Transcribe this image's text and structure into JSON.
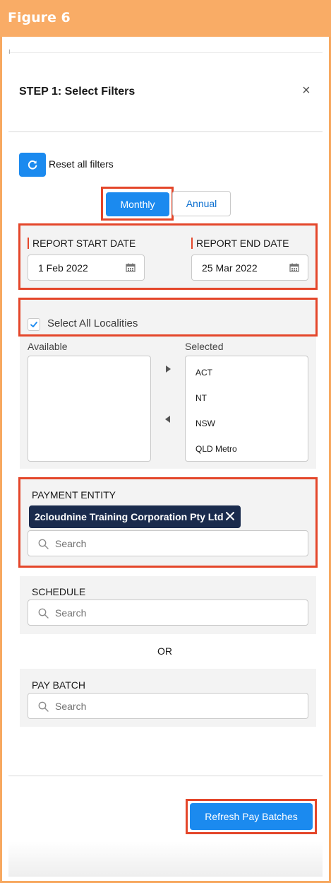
{
  "figure": {
    "title": "Figure 6"
  },
  "modal": {
    "title": "STEP 1: Select Filters",
    "close_label": "×"
  },
  "reset": {
    "label": "Reset all filters",
    "icon": "refresh-icon"
  },
  "period_toggle": {
    "options": [
      "Monthly",
      "Annual"
    ],
    "selected": "Monthly"
  },
  "dates": {
    "start_label": "REPORT START DATE",
    "start_value": "1 Feb 2022",
    "end_label": "REPORT END DATE",
    "end_value": "25 Mar 2022"
  },
  "localities": {
    "select_all_label": "Select All Localities",
    "select_all_checked": true,
    "available_label": "Available",
    "selected_label": "Selected",
    "available_items": [],
    "selected_items": [
      "ACT",
      "NT",
      "NSW",
      "QLD Metro"
    ]
  },
  "payment_entity": {
    "label": "PAYMENT ENTITY",
    "selected_pill": "2cloudnine Training Corporation Pty Ltd",
    "search_placeholder": "Search"
  },
  "schedule": {
    "label": "SCHEDULE",
    "search_placeholder": "Search"
  },
  "or_label": "OR",
  "pay_batch": {
    "label": "PAY BATCH",
    "search_placeholder": "Search"
  },
  "footer": {
    "refresh_label": "Refresh Pay Batches"
  },
  "colors": {
    "brand_blue": "#1b8aef",
    "highlight_red": "#e4462a",
    "figure_orange": "#f9ac66",
    "pill_navy": "#1a2b4d"
  }
}
